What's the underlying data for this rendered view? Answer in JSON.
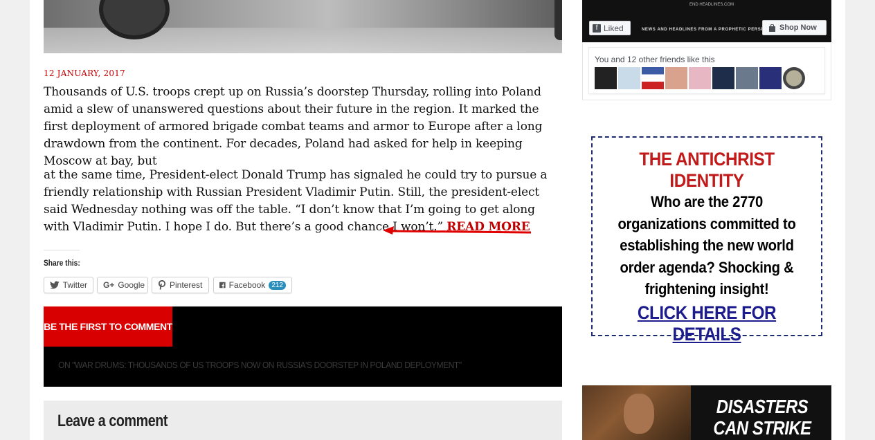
{
  "article": {
    "date": "12 JANUARY, 2017",
    "paragraph1": "Thousands of U.S. troops crept up on Russia’s doorstep Thursday, rolling into Poland amid a slew of unanswered questions about their future in the region. It marked the first deployment of armored brigade combat teams and armor to Europe after a long drawdown from the continent. For decades, Poland had asked for help in keeping Moscow at bay, but",
    "paragraph2": "at the same time, President-elect Donald Trump has signaled he could try to pursue a friendly relationship with Russian President Vladimir Putin. Still, the president-elect said Wednesday nothing was off the table. “I don’t know that I’m going to get along with Vladimir Putin. I hope I do. But there’s a good chance I won’t.”",
    "read_more": "READ MORE",
    "accent_color": "#c00000"
  },
  "share": {
    "title": "Share this:",
    "buttons": [
      {
        "label": "Twitter",
        "icon": "twitter-icon"
      },
      {
        "label": "Google",
        "icon": "google-plus-icon"
      },
      {
        "label": "Pinterest",
        "icon": "pinterest-icon"
      },
      {
        "label": "Facebook",
        "icon": "facebook-icon",
        "count": "212"
      }
    ]
  },
  "comments": {
    "first_label": "BE THE FIRST TO COMMENT",
    "on_label": "ON \"WAR DRUMS: THOUSANDS OF US TROOPS NOW ON RUSSIA'S DOORSTEP IN POLAND DEPLOYMENT\"",
    "leave_title": "Leave a comment"
  },
  "sidebar": {
    "fb": {
      "logo_text": "END HEADLINES.COM",
      "tagline": "NEWS AND HEADLINES FROM A PROPHETIC PERSPEC",
      "liked_label": "Liked",
      "shop_label": "Shop Now",
      "friends_text": "You and 12 other friends like this"
    },
    "ad": {
      "title": "THE ANTICHRIST IDENTITY",
      "body": "Who are the 2770 organizations committed to establishing the new world order agenda? Shocking & frightening insight!",
      "link": "CLICK HERE FOR DETAILS",
      "title_color": "#c11a1a",
      "link_color": "#1c1c8c"
    },
    "disaster": {
      "text": "DISASTERS CAN STRIKE AT ANY"
    }
  }
}
